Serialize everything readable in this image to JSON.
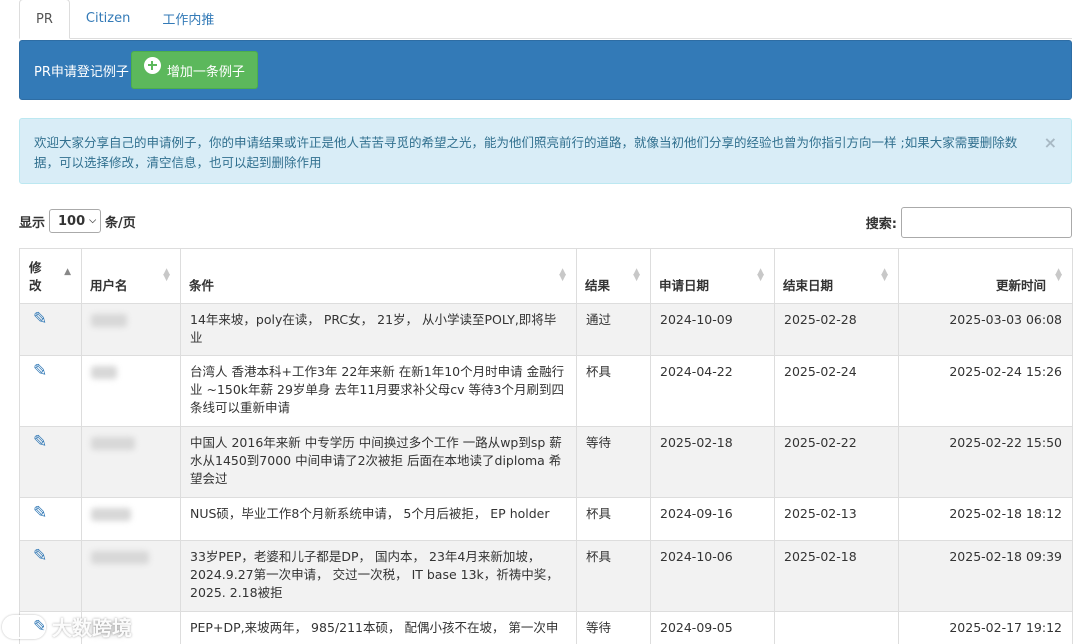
{
  "tabs": [
    {
      "label": "PR",
      "active": true
    },
    {
      "label": "Citizen",
      "active": false
    },
    {
      "label": "工作内推",
      "active": false
    }
  ],
  "header": {
    "title": "PR申请登记例子",
    "add_label": "增加一条例子"
  },
  "alert": {
    "text": "欢迎大家分享自己的申请例子，你的申请结果或许正是他人苦苦寻觅的希望之光，能为他们照亮前行的道路，就像当初他们分享的经验也曾为你指引方向一样 ;如果大家需要删除数据，可以选择修改，清空信息，也可以起到删除作用",
    "close": "×"
  },
  "controls": {
    "show_label": "显示",
    "page_size": "100",
    "per_page_label": "条/页",
    "search_label": "搜索:"
  },
  "table": {
    "headers": [
      "修改",
      "用户名",
      "条件",
      "结果",
      "申请日期",
      "结束日期",
      "更新时间"
    ],
    "rows": [
      {
        "condition": "14年来坡，poly在读， PRC女， 21岁， 从小学读至POLY,即将毕业",
        "result": "通过",
        "apply_date": "2024-10-09",
        "end_date": "2025-02-28",
        "updated": "2025-03-03 06:08"
      },
      {
        "condition": "台湾人 香港本科+工作3年 22年来新 在新1年10个月时申请 金融行业 ~150k年薪 29岁单身 去年11月要求补父母cv 等待3个月刷到四条线可以重新申请",
        "result": "杯具",
        "apply_date": "2024-04-22",
        "end_date": "2025-02-24",
        "updated": "2025-02-24 15:26"
      },
      {
        "condition": "中国人 2016年来新 中专学历 中间换过多个工作 一路从wp到sp 薪水从1450到7000 中间申请了2次被拒 后面在本地读了diploma 希望会过",
        "result": "等待",
        "apply_date": "2025-02-18",
        "end_date": "2025-02-22",
        "updated": "2025-02-22 15:50"
      },
      {
        "condition": "NUS硕，毕业工作8个月新系统申请， 5个月后被拒， EP holder",
        "result": "杯具",
        "apply_date": "2024-09-16",
        "end_date": "2025-02-13",
        "updated": "2025-02-18 18:12"
      },
      {
        "condition": "33岁PEP，老婆和儿子都是DP， 国内本， 23年4月来新加坡， 2024.9.27第一次申请， 交过一次税， IT base 13k，祈祷中奖， 2025. 2.18被拒",
        "result": "杯具",
        "apply_date": "2024-10-06",
        "end_date": "2025-02-18",
        "updated": "2025-02-18 09:39"
      },
      {
        "condition": "PEP+DP,来坡两年， 985/211本硕， 配偶小孩不在坡， 第一次申",
        "result": "等待",
        "apply_date": "2024-09-05",
        "end_date": "",
        "updated": "2025-02-17 19:12"
      }
    ]
  },
  "watermark": "大数跨境"
}
